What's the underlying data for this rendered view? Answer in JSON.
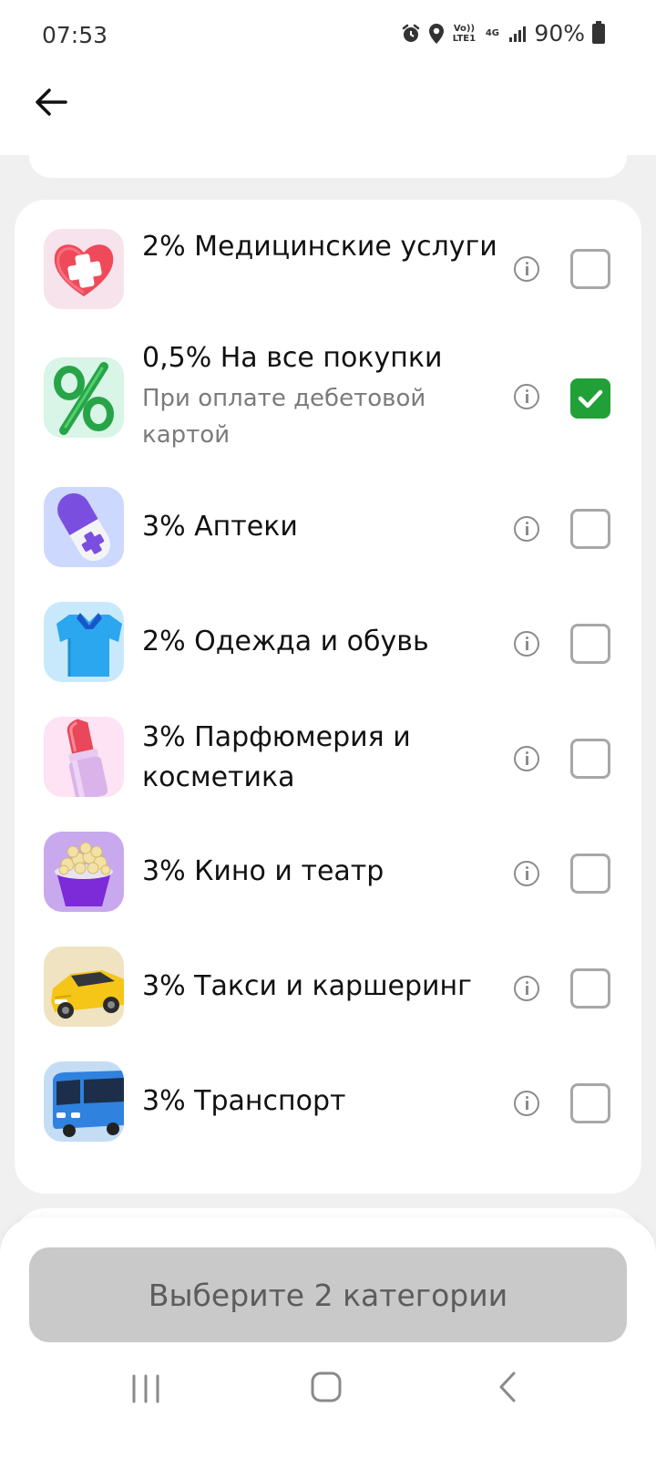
{
  "status": {
    "time": "07:53",
    "volte": "Vo)) LTE1",
    "network": "4G",
    "battery": "90%"
  },
  "items": [
    {
      "title": "2% Медицинские услуги",
      "subtitle": "",
      "checked": false,
      "icon": "heart-cross-icon"
    },
    {
      "title": "0,5% На все покупки",
      "subtitle": "При оплате дебетовой картой",
      "checked": true,
      "icon": "percent-icon"
    },
    {
      "title": "3% Аптеки",
      "subtitle": "",
      "checked": false,
      "icon": "pill-icon"
    },
    {
      "title": "2% Одежда и обувь",
      "subtitle": "",
      "checked": false,
      "icon": "polo-shirt-icon"
    },
    {
      "title": "3% Парфюмерия и косметика",
      "subtitle": "",
      "checked": false,
      "icon": "lipstick-icon"
    },
    {
      "title": "3% Кино и театр",
      "subtitle": "",
      "checked": false,
      "icon": "popcorn-icon"
    },
    {
      "title": "3% Такси и каршеринг",
      "subtitle": "",
      "checked": false,
      "icon": "taxi-car-icon"
    },
    {
      "title": "3% Транспорт",
      "subtitle": "",
      "checked": false,
      "icon": "bus-icon"
    }
  ],
  "cta": {
    "label": "Выберите 2 категории"
  },
  "colors": {
    "accent": "#21a038",
    "cta_bg": "#c9c9c9"
  }
}
